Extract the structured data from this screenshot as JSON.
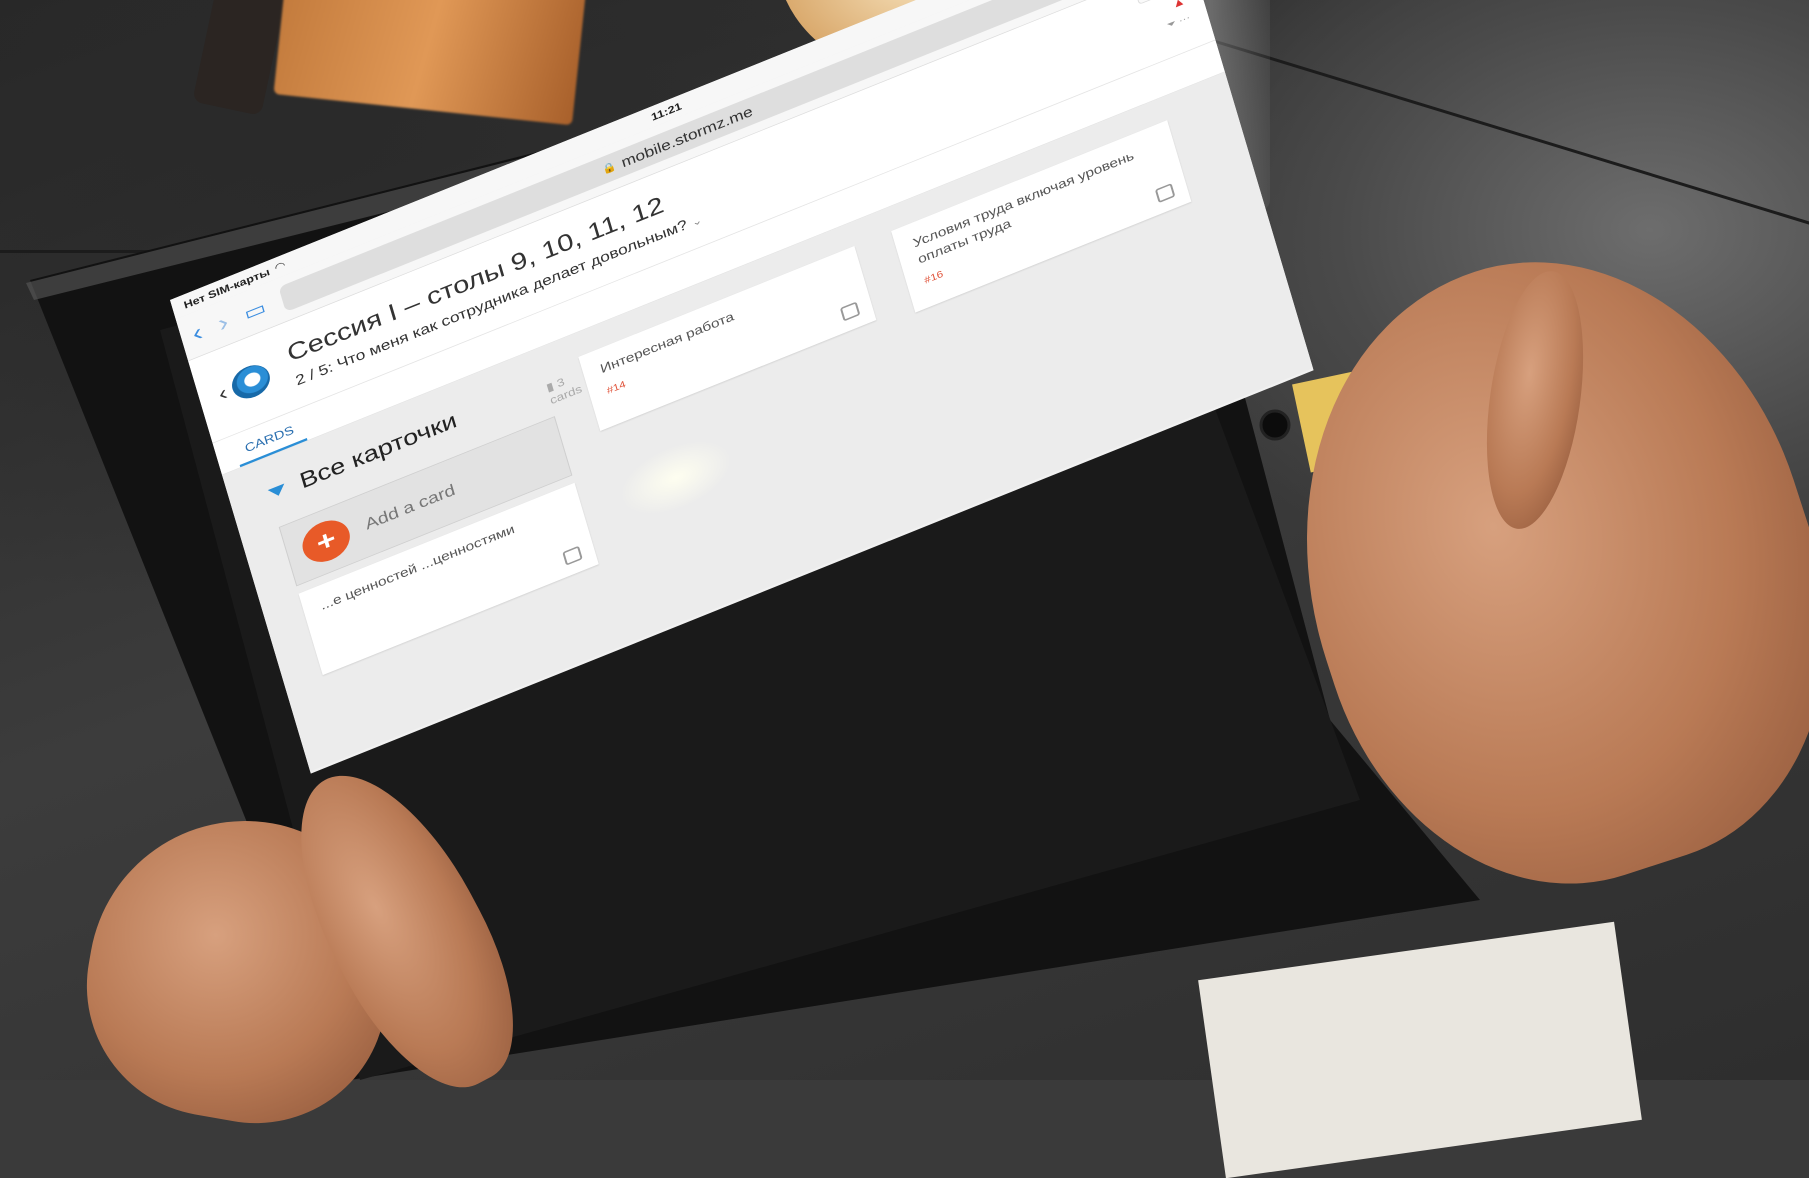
{
  "statusbar": {
    "carrier": "Нет SIM-карты",
    "time": "11:21"
  },
  "browser": {
    "url": "mobile.stormz.me",
    "back_icon": "chevron-left-icon",
    "forward_icon": "chevron-right-icon",
    "bookmarks_icon": "book-icon",
    "share_icon": "share-icon",
    "add_icon": "plus-icon",
    "tabs_icon": "tabs-icon",
    "reload_icon": "reload-icon"
  },
  "app": {
    "session_title": "Сессия I – столы 9, 10, 11, 12",
    "question": "2 / 5: Что меня как сотрудника делает довольным?",
    "tab_cards": "CARDS",
    "column_title": "Все карточки",
    "card_count": "3 cards",
    "add_card_label": "Add a card",
    "accent": "#2a8ed6",
    "add_button_color": "#e85a28"
  },
  "cards": [
    {
      "text": "Интересная работа",
      "num": "#14"
    },
    {
      "text": "Условия труда включая уровень оплаты труда",
      "num": "#16"
    },
    {
      "text": "...е ценностей ...ценностями",
      "num": ""
    }
  ]
}
